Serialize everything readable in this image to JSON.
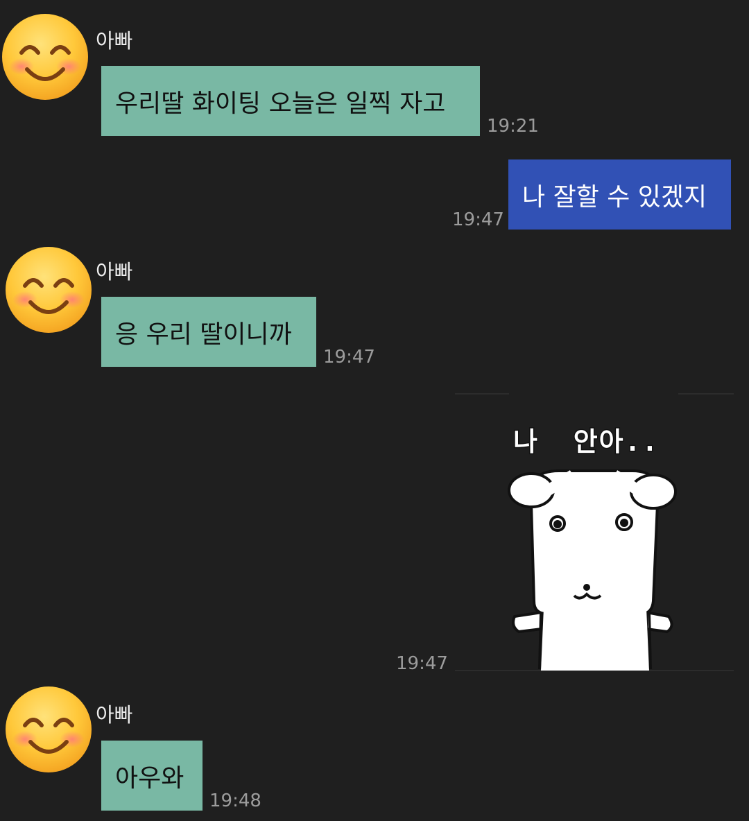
{
  "chat": {
    "messages": [
      {
        "sender": "아빠",
        "text": "우리딸 화이팅 오늘은 일찍 자고",
        "time": "19:21",
        "direction": "received"
      },
      {
        "text": "나 잘할 수 있겠지",
        "time": "19:47",
        "direction": "sent"
      },
      {
        "sender": "아빠",
        "text": "응 우리 딸이니까",
        "time": "19:47",
        "direction": "received"
      },
      {
        "sticker": {
          "caption": "나  안아..",
          "icon": "white-bear-sticker"
        },
        "time": "19:47",
        "direction": "sent"
      },
      {
        "sender": "아빠",
        "text": "아우와",
        "time": "19:48",
        "direction": "received"
      }
    ]
  },
  "colors": {
    "background": "#1f1f1f",
    "received_bubble": "#79b8a4",
    "sent_bubble": "#3151b5",
    "timestamp": "#9c9c9c"
  },
  "icons": {
    "avatar": "smiling-face-emoji-icon"
  }
}
